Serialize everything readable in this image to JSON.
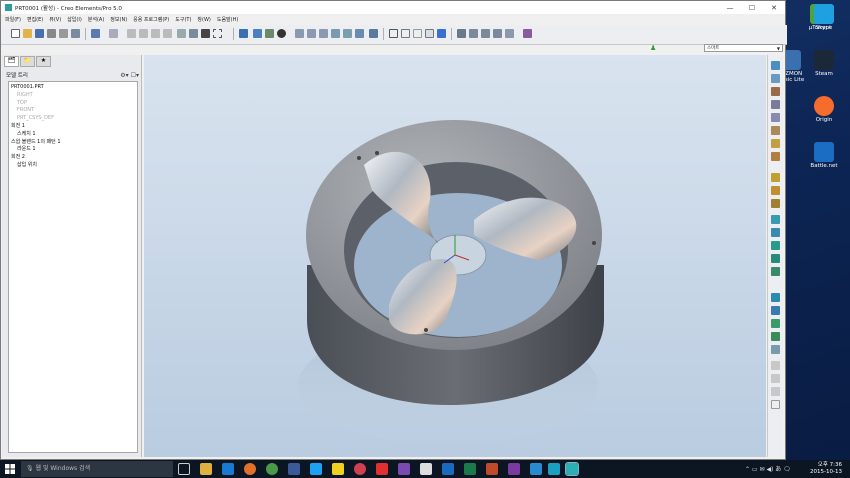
{
  "window": {
    "title": "PRT0001 (활성) - Creo Elements/Pro 5.0",
    "controls": [
      "—",
      "☐",
      "✕"
    ]
  },
  "menu": [
    "파일(F)",
    "편집(E)",
    "뷰(V)",
    "삽입(I)",
    "분석(A)",
    "정보(N)",
    "응용 프로그램(P)",
    "도구(T)",
    "창(W)",
    "도움말(H)"
  ],
  "selector": {
    "value": "스마트"
  },
  "model_tree": {
    "header": "모델 트리",
    "items": [
      {
        "label": "PRT0001.PRT",
        "dim": false,
        "level": 0
      },
      {
        "label": "RIGHT",
        "dim": true,
        "level": 1
      },
      {
        "label": "TOP",
        "dim": true,
        "level": 1
      },
      {
        "label": "FRONT",
        "dim": true,
        "level": 1
      },
      {
        "label": "PRT_CSYS_DEF",
        "dim": true,
        "level": 1
      },
      {
        "label": "회전 1",
        "dim": false,
        "level": 0
      },
      {
        "label": "스케치 1",
        "dim": false,
        "level": 1
      },
      {
        "label": "스윕 블렌드 1의 패턴 1",
        "dim": false,
        "level": 0
      },
      {
        "label": "라운드 1",
        "dim": false,
        "level": 1
      },
      {
        "label": "회전 2",
        "dim": false,
        "level": 0
      },
      {
        "label": "삽입 위치",
        "dim": false,
        "level": 1
      }
    ]
  },
  "desktop_icons": [
    {
      "label": "µTorrent",
      "color": "#4fa33a"
    },
    {
      "label": "Skype",
      "color": "#1fa0e0"
    },
    {
      "label": "AIZMON Basic Lite",
      "color": "#3a6fb0"
    },
    {
      "label": "Steam",
      "color": "#1b2838"
    },
    {
      "label": "Origin",
      "color": "#f56c2d"
    },
    {
      "label": "Battle.net",
      "color": "#1a6dc2"
    }
  ],
  "taskbar": {
    "search_placeholder": "웹 및 Windows 검색",
    "time": "오후 7:36",
    "date": "2015-10-13"
  }
}
